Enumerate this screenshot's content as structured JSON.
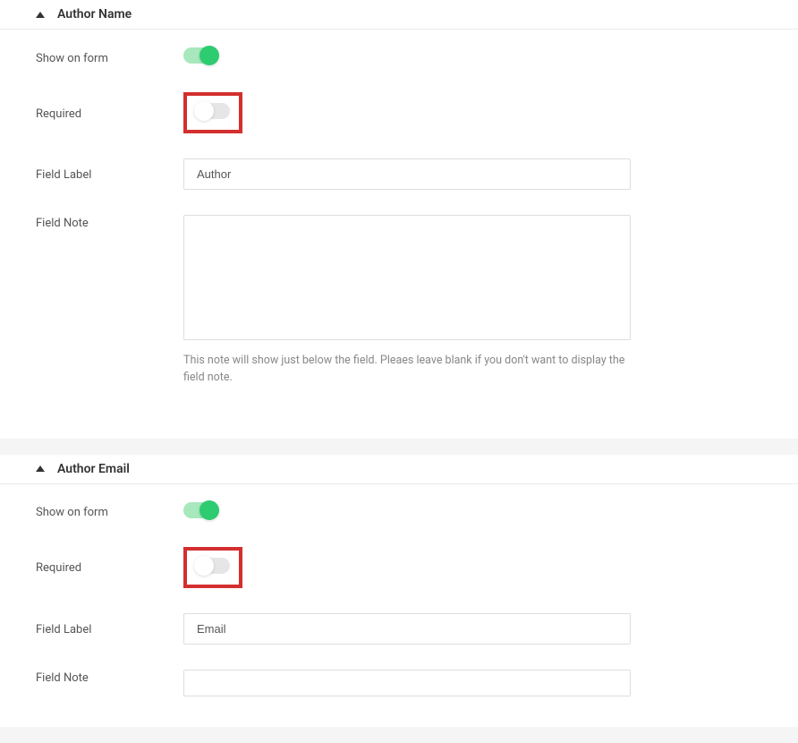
{
  "sections": [
    {
      "title": "Author Name",
      "show_on_form_label": "Show on form",
      "show_on_form_value": true,
      "required_label": "Required",
      "required_value": false,
      "required_highlighted": true,
      "field_label_label": "Field Label",
      "field_label_value": "Author",
      "field_note_label": "Field Note",
      "field_note_value": "",
      "field_note_help": "This note will show just below the field. Pleaes leave blank if you don't want to display the field note."
    },
    {
      "title": "Author Email",
      "show_on_form_label": "Show on form",
      "show_on_form_value": true,
      "required_label": "Required",
      "required_value": false,
      "required_highlighted": true,
      "field_label_label": "Field Label",
      "field_label_value": "Email",
      "field_note_label": "Field Note",
      "field_note_value": "",
      "field_note_help": ""
    }
  ]
}
